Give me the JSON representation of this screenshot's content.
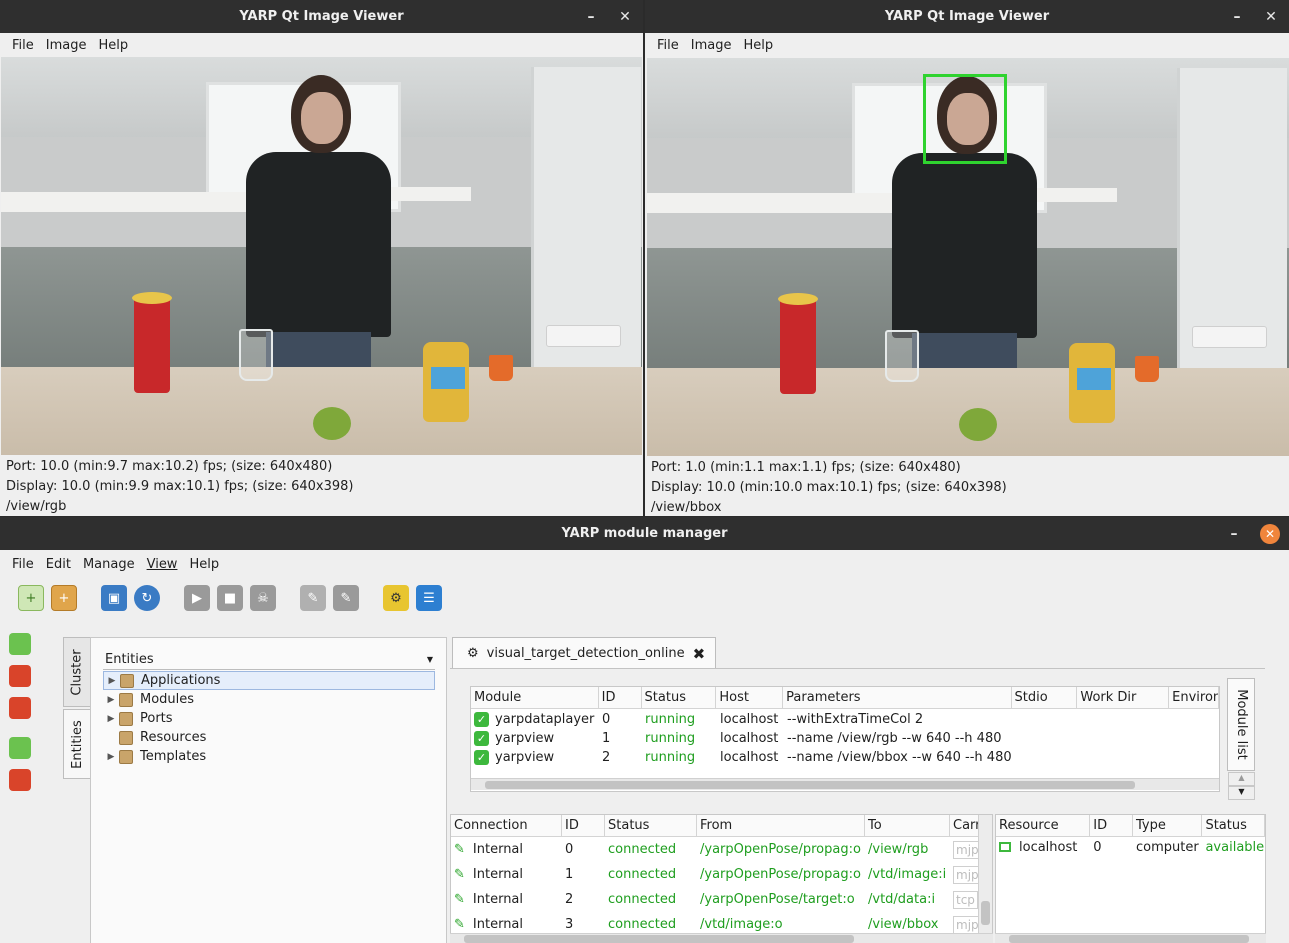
{
  "viewer_left": {
    "title": "YARP Qt Image Viewer",
    "menu": [
      "File",
      "Image",
      "Help"
    ],
    "port_line": "Port: 10.0 (min:9.7 max:10.2) fps; (size: 640x480)",
    "display_line": "Display: 10.0 (min:9.9 max:10.1) fps; (size: 640x398)",
    "port_name": "/view/rgb"
  },
  "viewer_right": {
    "title": "YARP Qt Image Viewer",
    "menu": [
      "File",
      "Image",
      "Help"
    ],
    "port_line": "Port: 1.0 (min:1.1 max:1.1) fps; (size: 640x480)",
    "display_line": "Display: 10.0 (min:10.0 max:10.1) fps; (size: 640x398)",
    "port_name": "/view/bbox"
  },
  "manager": {
    "title": "YARP module manager",
    "menu": [
      "File",
      "Edit",
      "Manage",
      "View",
      "Help"
    ],
    "side_tabs": [
      "Cluster",
      "Entities"
    ],
    "entities_header": "Entities",
    "tree": [
      {
        "label": "Applications",
        "expandable": true,
        "selected": true
      },
      {
        "label": "Modules",
        "expandable": true,
        "selected": false
      },
      {
        "label": "Ports",
        "expandable": true,
        "selected": false
      },
      {
        "label": "Resources",
        "expandable": false,
        "selected": false
      },
      {
        "label": "Templates",
        "expandable": true,
        "selected": false
      }
    ],
    "doc_tab": "visual_target_detection_online",
    "module_list_tab": "Module list",
    "modules": {
      "headers": [
        "Module",
        "ID",
        "Status",
        "Host",
        "Parameters",
        "Stdio",
        "Work Dir",
        "Environ"
      ],
      "rows": [
        [
          "yarpdataplayer",
          "0",
          "running",
          "localhost",
          "--withExtraTimeCol 2"
        ],
        [
          "yarpview",
          "1",
          "running",
          "localhost",
          "--name /view/rgb --w 640 --h 480"
        ],
        [
          "yarpview",
          "2",
          "running",
          "localhost",
          "--name /view/bbox --w 640 --h 480"
        ]
      ]
    },
    "connections": {
      "headers": [
        "Connection",
        "ID",
        "Status",
        "From",
        "To",
        "Carr"
      ],
      "rows": [
        [
          "Internal",
          "0",
          "connected",
          "/yarpOpenPose/propag:o",
          "/view/rgb",
          "mjp"
        ],
        [
          "Internal",
          "1",
          "connected",
          "/yarpOpenPose/propag:o",
          "/vtd/image:i",
          "mjp"
        ],
        [
          "Internal",
          "2",
          "connected",
          "/yarpOpenPose/target:o",
          "/vtd/data:i",
          "tcp"
        ],
        [
          "Internal",
          "3",
          "connected",
          "/vtd/image:o",
          "/view/bbox",
          "mjp"
        ]
      ]
    },
    "resources": {
      "headers": [
        "Resource",
        "ID",
        "Type",
        "Status"
      ],
      "rows": [
        [
          "localhost",
          "0",
          "computer",
          "available"
        ]
      ]
    }
  }
}
